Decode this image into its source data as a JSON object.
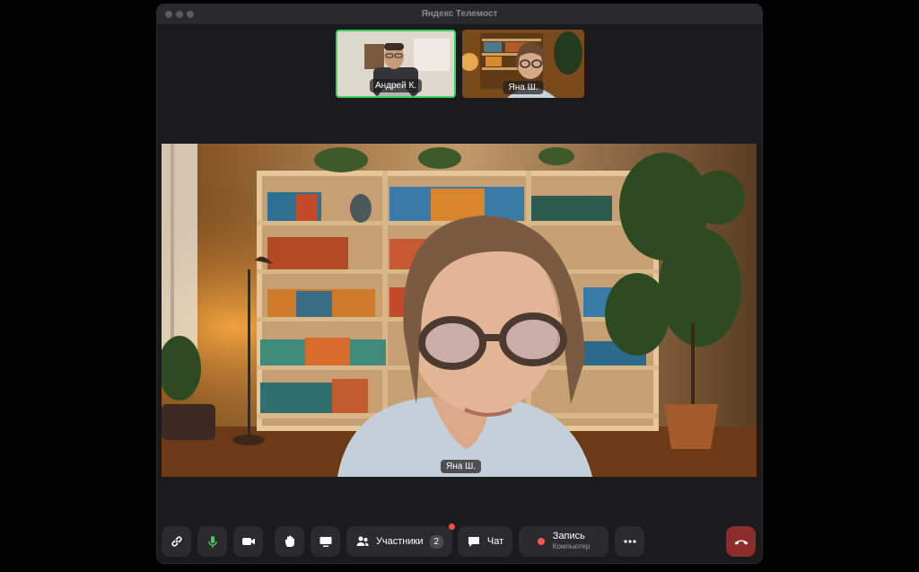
{
  "window": {
    "title": "Яндекс Телемост"
  },
  "thumbnails": [
    {
      "name": "Андрей К.",
      "active_speaker": true
    },
    {
      "name": "Яна Ш.",
      "active_speaker": false
    }
  ],
  "main_video": {
    "name": "Яна Ш."
  },
  "toolbar": {
    "participants_label": "Участники",
    "participants_count": "2",
    "chat_label": "Чат",
    "record_label": "Запись",
    "record_sublabel": "Компьютер",
    "icons": [
      "link-icon",
      "microphone-icon",
      "camera-icon",
      "raise-hand-icon",
      "screen-share-icon",
      "participants-icon",
      "chat-icon",
      "record-icon",
      "more-icon",
      "end-call-icon"
    ]
  },
  "colors": {
    "accent_active": "#3fcf62",
    "mic_green": "#3fcf62",
    "record_red": "#ff5a4e",
    "end_call": "#8d2d2b"
  }
}
